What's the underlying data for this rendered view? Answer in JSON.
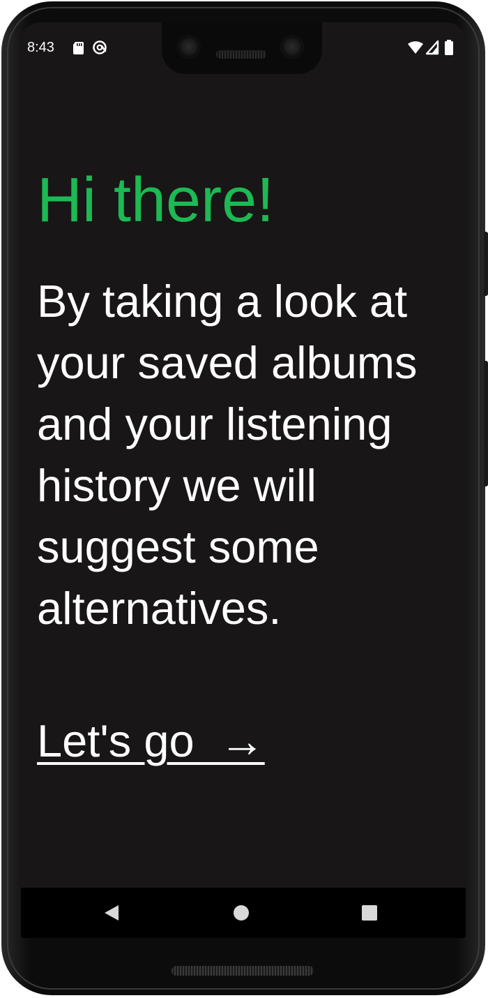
{
  "status_bar": {
    "time": "8:43",
    "left_icons": [
      "sd-card-icon",
      "at-sign-icon"
    ],
    "right_icons": [
      "wifi-icon",
      "signal-icon",
      "battery-icon"
    ]
  },
  "main": {
    "greeting": "Hi there!",
    "intro": "By taking a look at your saved albums and your listening history we will suggest some alternatives.",
    "cta_label": "Let's go  →"
  },
  "nav_bar": {
    "buttons": [
      "back-icon",
      "home-icon",
      "recents-icon"
    ]
  },
  "colors": {
    "accent": "#1db954",
    "background": "#181616",
    "text": "#ffffff",
    "nav_background": "#000000"
  }
}
